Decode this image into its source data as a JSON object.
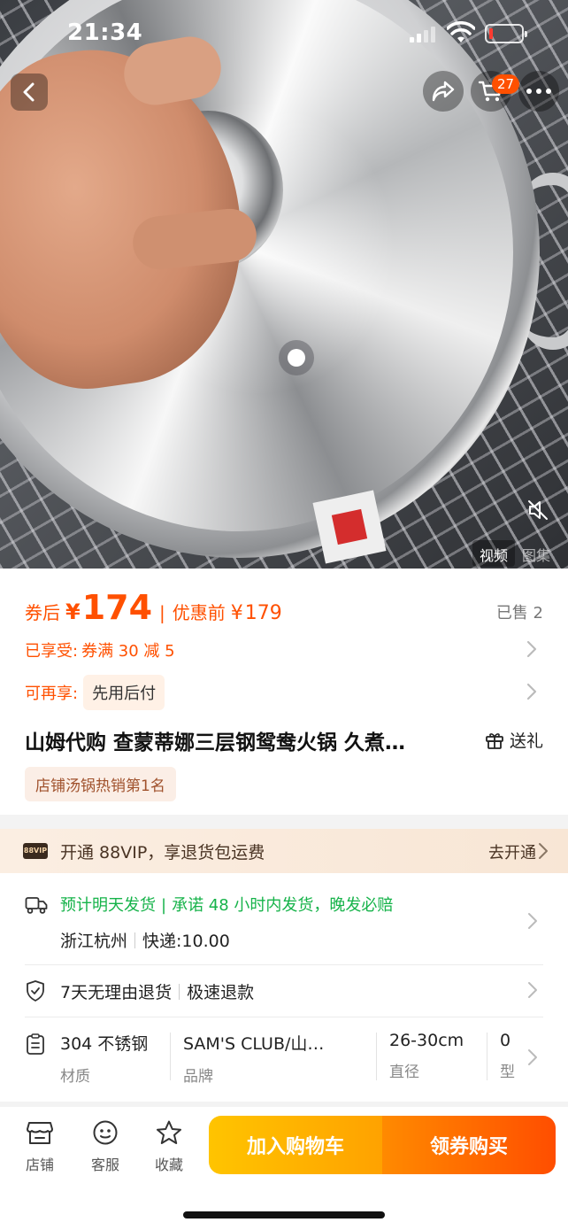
{
  "status_bar": {
    "time": "21:34"
  },
  "header": {
    "cart_count": "27"
  },
  "media": {
    "tabs": [
      "视频",
      "图集"
    ],
    "active_tab": "视频"
  },
  "price": {
    "after_coupon_label": "券后",
    "currency": "¥",
    "after_coupon_value": "174",
    "before_label": "优惠前",
    "before_value": "179",
    "sold": "已售 2"
  },
  "promotions": {
    "enjoyed_label": "已享受:",
    "enjoyed_value": "券满 30 减 5",
    "more_label": "可再享:",
    "more_value": "先用后付"
  },
  "product": {
    "title": "山姆代购 查蒙蒂娜三层钢鸳鸯火锅 久煮…",
    "gift_label": "送礼",
    "rank_tag": "店铺汤锅热销第1名"
  },
  "vip": {
    "badge": "88VIP",
    "text": "开通 88VIP，享退货包运费",
    "action": "去开通"
  },
  "shipping": {
    "estimate": "预计明天发货",
    "promise": "承诺 48 小时内发货，晚发必赔",
    "origin": "浙江杭州",
    "fee_label": "快递:",
    "fee_value": "10.00"
  },
  "service": {
    "return": "7天无理由退货",
    "refund": "极速退款"
  },
  "params": [
    {
      "value": "304 不锈钢",
      "key": "材质"
    },
    {
      "value": "SAM'S CLUB/山…",
      "key": "品牌"
    },
    {
      "value": "26-30cm",
      "key": "直径"
    },
    {
      "value": "0",
      "key": "型"
    }
  ],
  "bottom_bar": {
    "tools": [
      "店铺",
      "客服",
      "收藏"
    ],
    "add_to_cart": "加入购物车",
    "buy_with_coupon": "领券购买"
  },
  "colors": {
    "accent": "#ff5000",
    "green": "#16b34a",
    "cart_button": "#ffb000"
  }
}
